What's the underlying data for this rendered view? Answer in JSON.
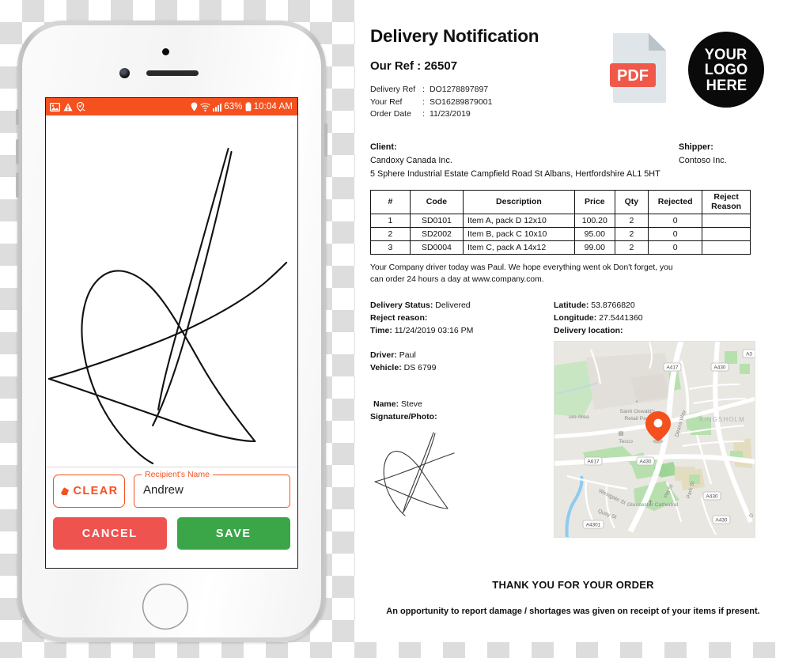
{
  "phone": {
    "statusbar": {
      "left_icons": [
        "image-icon",
        "warning-icon",
        "location-check-icon"
      ],
      "location_icon": "location-pin-icon",
      "wifi_icon": "wifi-icon",
      "signal_icon": "signal-bars-icon",
      "battery_percent": "63%",
      "battery_icon": "battery-icon",
      "time": "10:04 AM",
      "bg_color": "#f4511e"
    },
    "signature_pad": {
      "label": "signature-drawing-area"
    },
    "clear_button": {
      "label": "CLEAR",
      "icon": "eraser-icon"
    },
    "name_field": {
      "label": "Recipient's Name",
      "value": "Andrew",
      "placeholder": "Recipient's Name"
    },
    "cancel_button": {
      "label": "CANCEL",
      "color": "#ef5350"
    },
    "save_button": {
      "label": "SAVE",
      "color": "#3aa648"
    }
  },
  "document": {
    "title": "Delivery Notification",
    "our_ref_line": "Our Ref :  26507",
    "refs": [
      {
        "key": "Delivery Ref",
        "colon": ":",
        "value": "DO1278897897"
      },
      {
        "key": "Your Ref",
        "colon": ":",
        "value": "SO16289879001"
      },
      {
        "key": "Order Date",
        "colon": ":",
        "value": "11/23/2019"
      }
    ],
    "pdf_badge": {
      "text": "PDF",
      "icon": "pdf-file-icon",
      "color": "#f0584a"
    },
    "logo": {
      "line1": "YOUR",
      "line2": "LOGO",
      "line3": "HERE"
    },
    "client": {
      "heading": "Client:",
      "name": "Candoxy Canada Inc.",
      "address": "5 Sphere Industrial Estate Campfield Road St Albans, Hertfordshire AL1 5HT"
    },
    "shipper": {
      "heading": "Shipper:",
      "name": "Contoso Inc."
    },
    "items_table": {
      "columns": [
        "#",
        "Code",
        "Description",
        "Price",
        "Qty",
        "Rejected",
        "Reject Reason"
      ],
      "rows": [
        {
          "num": "1",
          "code": "SD0101",
          "description": "Item A, pack D 12x10",
          "price": "100.20",
          "qty": "2",
          "rejected": "0",
          "reject_reason": ""
        },
        {
          "num": "2",
          "code": "SD2002",
          "description": "Item B, pack C 10x10",
          "price": "95.00",
          "qty": "2",
          "rejected": "0",
          "reject_reason": ""
        },
        {
          "num": "3",
          "code": "SD0004",
          "description": "Item C, pack A 14x12",
          "price": "99.00",
          "qty": "2",
          "rejected": "0",
          "reject_reason": ""
        }
      ]
    },
    "notice": "Your Company driver today was Paul.  We hope everything went ok  Don't forget, you can order 24 hours a day at www.company.com.",
    "delivery": {
      "status_label": "Delivery Status:",
      "status_value": "Delivered",
      "reject_reason_label": "Reject reason:",
      "reject_reason_value": "",
      "time_label": "Time:",
      "time_value": "11/24/2019 03:16 PM",
      "driver_label": "Driver:",
      "driver_value": "Paul",
      "vehicle_label": "Vehicle:",
      "vehicle_value": "DS 6799",
      "name_label": "Name:",
      "name_value": "Steve",
      "signature_label": "Signature/Photo:"
    },
    "geo": {
      "latitude_label": "Latitude:",
      "latitude_value": "53.8766820",
      "longitude_label": "Longitude:",
      "longitude_value": "27.5441360",
      "location_label": "Delivery location:"
    },
    "map": {
      "marker": "map-pin-marker",
      "labels": [
        "A417",
        "A430",
        "A430",
        "A430",
        "A617",
        "A430",
        "A4301",
        "A3",
        "Deans Way",
        "KINGSHOLM",
        "Saint Oswald's",
        "Retail Park",
        "Tesco",
        "ure Area",
        "Westgate St",
        "Quay St",
        "Pitt St",
        "Park St",
        "Gloucester Cathedral",
        "G"
      ]
    },
    "footer": {
      "thank_you": "THANK YOU FOR YOUR ORDER",
      "opportunity": "An opportunity to report damage / shortages was given on receipt of your items if present."
    }
  }
}
